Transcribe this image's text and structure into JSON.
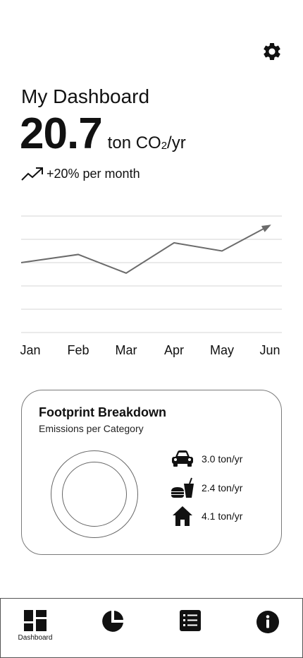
{
  "header": {
    "settings_icon": "gear-icon"
  },
  "dashboard": {
    "title": "My Dashboard",
    "value": "20.7",
    "unit_main": "ton CO",
    "unit_sub": "2",
    "unit_tail": "/yr",
    "trend_icon": "trending-up-icon",
    "trend_text": "+20% per month"
  },
  "chart_data": {
    "type": "line",
    "categories": [
      "Jan",
      "Feb",
      "Mar",
      "Apr",
      "May",
      "Jun"
    ],
    "values": [
      3.0,
      3.35,
      2.55,
      3.85,
      3.5,
      4.6
    ],
    "ylim": [
      0,
      5
    ],
    "grid": true,
    "title": "",
    "xlabel": "",
    "ylabel": ""
  },
  "breakdown": {
    "title": "Footprint Breakdown",
    "subtitle": "Emissions per Category",
    "items": [
      {
        "icon": "car-icon",
        "value": "3.0 ton/yr"
      },
      {
        "icon": "food-icon",
        "value": "2.4 ton/yr"
      },
      {
        "icon": "house-icon",
        "value": "4.1 ton/yr"
      }
    ]
  },
  "nav": {
    "items": [
      {
        "icon": "dashboard-icon",
        "label": "Dashboard"
      },
      {
        "icon": "pie-chart-icon",
        "label": ""
      },
      {
        "icon": "list-icon",
        "label": ""
      },
      {
        "icon": "info-icon",
        "label": ""
      }
    ]
  }
}
